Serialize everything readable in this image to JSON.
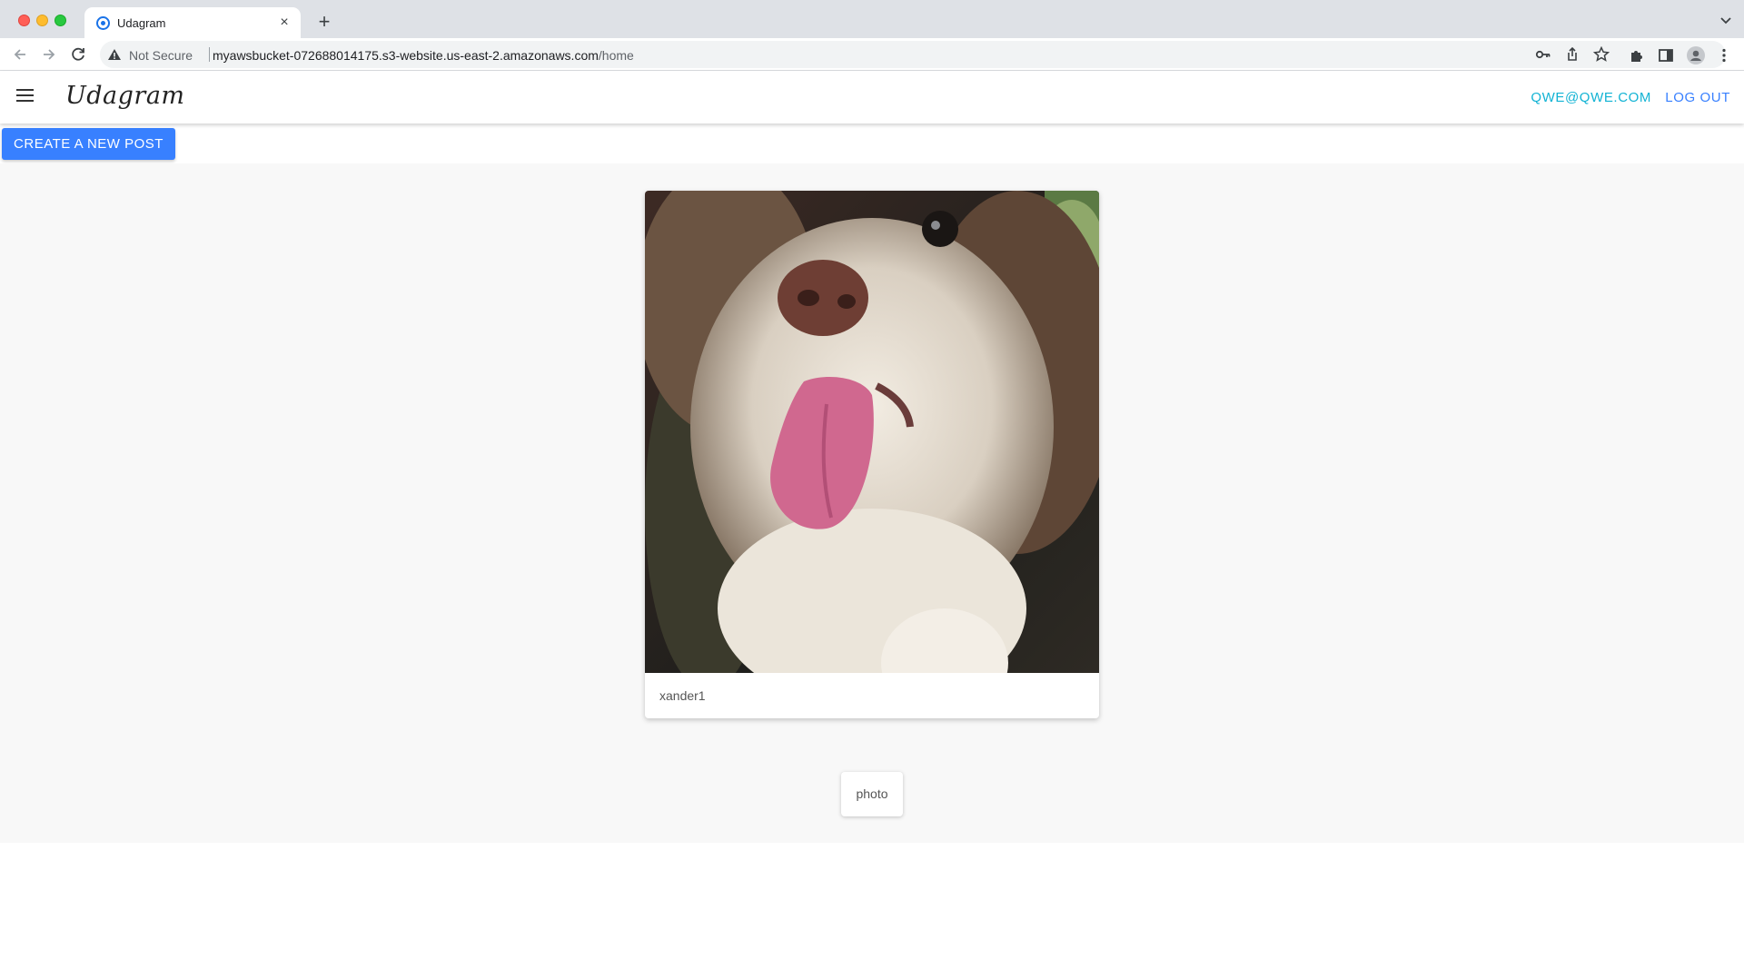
{
  "browser": {
    "tab_title": "Udagram",
    "tab_close": "×",
    "new_tab": "+",
    "security_label": "Not Secure",
    "url_host": "myawsbucket-072688014175.s3-website.us-east-2.amazonaws.com",
    "url_path": "/home",
    "icons": [
      "back-icon",
      "forward-icon",
      "reload-icon",
      "warning-icon",
      "key-icon",
      "share-icon",
      "star-icon",
      "extensions-icon",
      "sidepanel-icon",
      "profile-icon",
      "kebab-menu-icon",
      "tab-search-icon"
    ]
  },
  "header": {
    "brand": "Udagram",
    "user_email": "QWE@QWE.COM",
    "logout_label": "LOG OUT"
  },
  "actions": {
    "create_post_label": "CREATE A NEW POST"
  },
  "feed": {
    "items": [
      {
        "caption": "xander1"
      }
    ]
  },
  "pagination": {
    "chip_label": "photo"
  },
  "colors": {
    "primary": "#3880ff",
    "user_link": "#12b3d4",
    "feed_background": "#f8f8f8"
  }
}
